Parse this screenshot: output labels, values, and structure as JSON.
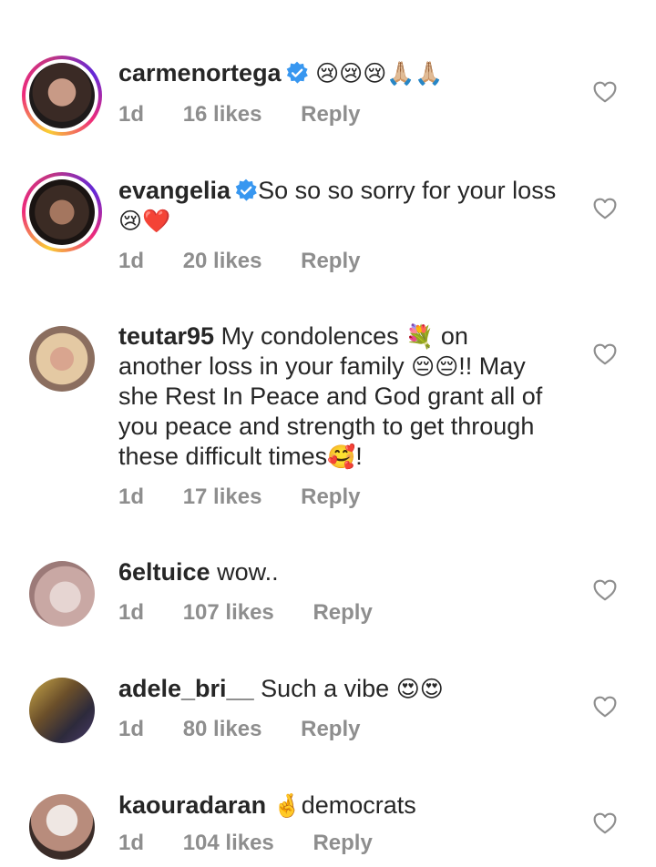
{
  "comments": [
    {
      "username": "carmenortega",
      "verified": true,
      "text": "",
      "emoji": "😢😢😢🙏🏼🙏🏼",
      "time": "1d",
      "likes": "16 likes",
      "reply": "Reply"
    },
    {
      "username": "evangelia",
      "verified": true,
      "text": "So so so sorry for your loss",
      "emoji": "😢❤️",
      "time": "1d",
      "likes": "20 likes",
      "reply": "Reply"
    },
    {
      "username": "teutar95",
      "verified": false,
      "text_line1": "My condolences",
      "emoji1": "💐",
      "text_line1b": "on",
      "text_line2": "another loss in your family",
      "emoji2": "😔😔",
      "text_line2b": "!! May",
      "text_line3": "she Rest In Peace and God grant all of",
      "text_line4": "you peace and strength to get through",
      "text_line5": "these difficult times",
      "emoji3": "🥰",
      "text_line5b": "!",
      "time": "1d",
      "likes": "17 likes",
      "reply": "Reply"
    },
    {
      "username": "6eltuice",
      "verified": false,
      "text": "wow..",
      "time": "1d",
      "likes": "107 likes",
      "reply": "Reply"
    },
    {
      "username": "adele_bri__",
      "verified": false,
      "text": "Such a vibe",
      "emoji": "😍😍",
      "time": "1d",
      "likes": "80 likes",
      "reply": "Reply"
    },
    {
      "username": "kaouradaran",
      "verified": false,
      "emoji": "🤞",
      "text": "democrats",
      "time": "1d",
      "likes": "104 likes",
      "reply": "Reply"
    }
  ],
  "icons": {
    "verified": "verified-badge-icon",
    "like": "heart-outline-icon"
  },
  "colors": {
    "verified": "#3897f0",
    "meta": "#8e8e8e",
    "text": "#262626"
  }
}
